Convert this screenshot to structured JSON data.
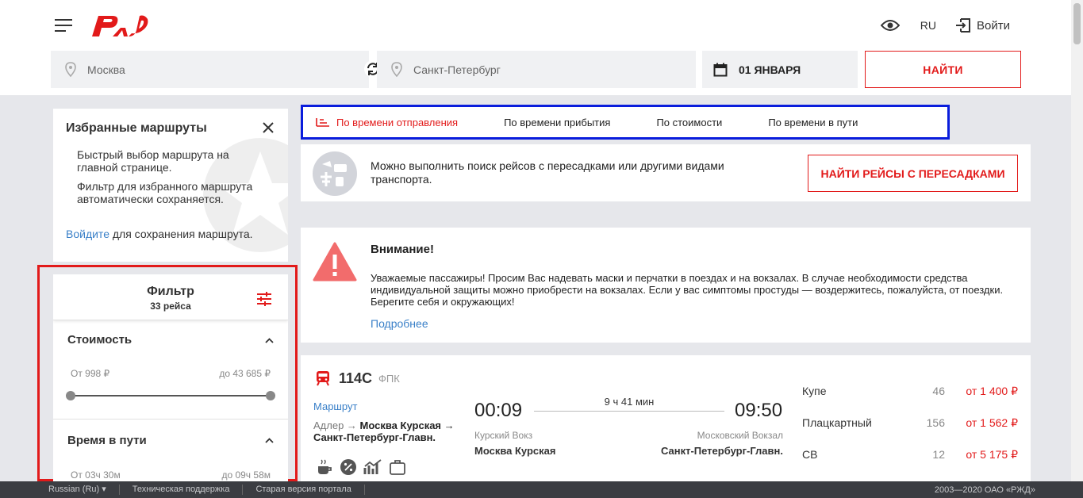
{
  "header": {
    "lang": "RU",
    "login_label": "Войти"
  },
  "search": {
    "from": "Москва",
    "to": "Санкт-Петербург",
    "date": "01 ЯНВАРЯ",
    "find_label": "НАЙТИ"
  },
  "favorites": {
    "title": "Избранные маршруты",
    "p1": "Быстрый выбор маршрута на главной странице.",
    "p2": "Фильтр для избранного маршрута автоматически сохраняется.",
    "login_link": "Войдите",
    "login_tail": " для сохранения маршрута."
  },
  "filter": {
    "title": "Фильтр",
    "count": "33 рейса",
    "cost": {
      "title": "Стоимость",
      "from": "От 998 ₽",
      "to": "до 43 685 ₽"
    },
    "travel_time": {
      "title": "Время в пути",
      "from": "От 03ч 30м",
      "to": "до 09ч 58м"
    }
  },
  "sort": {
    "items": [
      {
        "label": "По времени отправления",
        "active": true
      },
      {
        "label": "По времени прибытия",
        "active": false
      },
      {
        "label": "По стоимости",
        "active": false
      },
      {
        "label": "По времени в пути",
        "active": false
      }
    ]
  },
  "transfer": {
    "text": "Можно выполнить поиск рейсов с пересадками или другими видами транспорта.",
    "button": "НАЙТИ РЕЙСЫ С ПЕРЕСАДКАМИ"
  },
  "attention": {
    "title": "Внимание!",
    "text": "Уважаемые пассажиры! Просим Вас надевать маски и перчатки в поездах и на вокзалах. В случае необходимости средства индивидуальной защиты можно приобрести на вокзалах. Если у вас симптомы простуды — воздержитесь, пожалуйста, от поездки. Берегите себя и окружающих!",
    "link": "Подробнее"
  },
  "train": {
    "number": "114С",
    "carrier": "ФПК",
    "route_label": "Маршрут",
    "route_prefix": "Адлер → ",
    "route_bold": "Москва Курская → Санкт-Петербург-Главн.",
    "departure_time": "00:09",
    "arrival_time": "09:50",
    "duration": "9 ч 41 мин",
    "dep_station": "Курский Вокз",
    "dep_city": "Москва Курская",
    "arr_station": "Московский Вокзал",
    "arr_city": "Санкт-Петербург-Главн.",
    "classes": [
      {
        "name": "Купе",
        "seats": "46",
        "price": "от 1 400 ₽"
      },
      {
        "name": "Плацкартный",
        "seats": "156",
        "price": "от 1 562 ₽"
      },
      {
        "name": "СВ",
        "seats": "12",
        "price": "от 5 175 ₽"
      }
    ]
  },
  "footer": {
    "language": "Russian  (Ru)",
    "support": "Техническая поддержка",
    "old_version": "Старая версия портала",
    "copyright": "2003—2020 ОАО «РЖД»"
  },
  "colors": {
    "brand_red": "#e21a1a",
    "link_blue": "#3a80c8",
    "highlight_blue": "#0a1ddc"
  }
}
